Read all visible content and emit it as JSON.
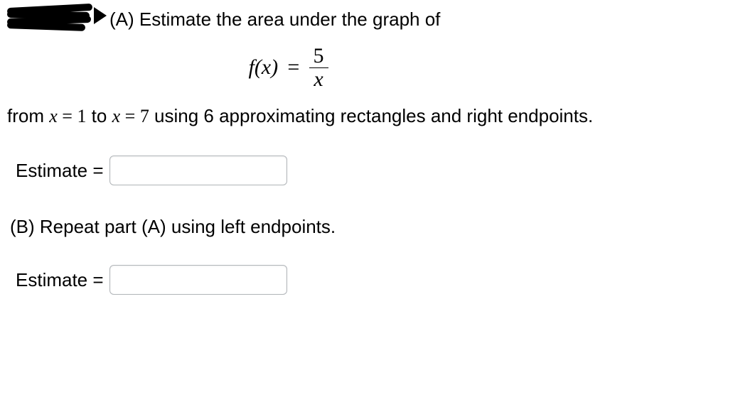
{
  "partA": {
    "label": "(A)",
    "prompt_line1": "Estimate the area under the graph of",
    "formula": {
      "lhs": "f(x)",
      "numerator": "5",
      "denominator": "x"
    },
    "prompt_line2_prefix": "from ",
    "from_var": "x",
    "from_eq": " = ",
    "from_val": "1",
    "to_text": " to ",
    "to_var": "x",
    "to_eq": " = ",
    "to_val": "7",
    "prompt_line2_suffix": " using 6 approximating rectangles and right endpoints.",
    "estimate_label": "Estimate =",
    "estimate_value": ""
  },
  "partB": {
    "prompt": "(B) Repeat part (A) using left endpoints.",
    "estimate_label": "Estimate =",
    "estimate_value": ""
  }
}
